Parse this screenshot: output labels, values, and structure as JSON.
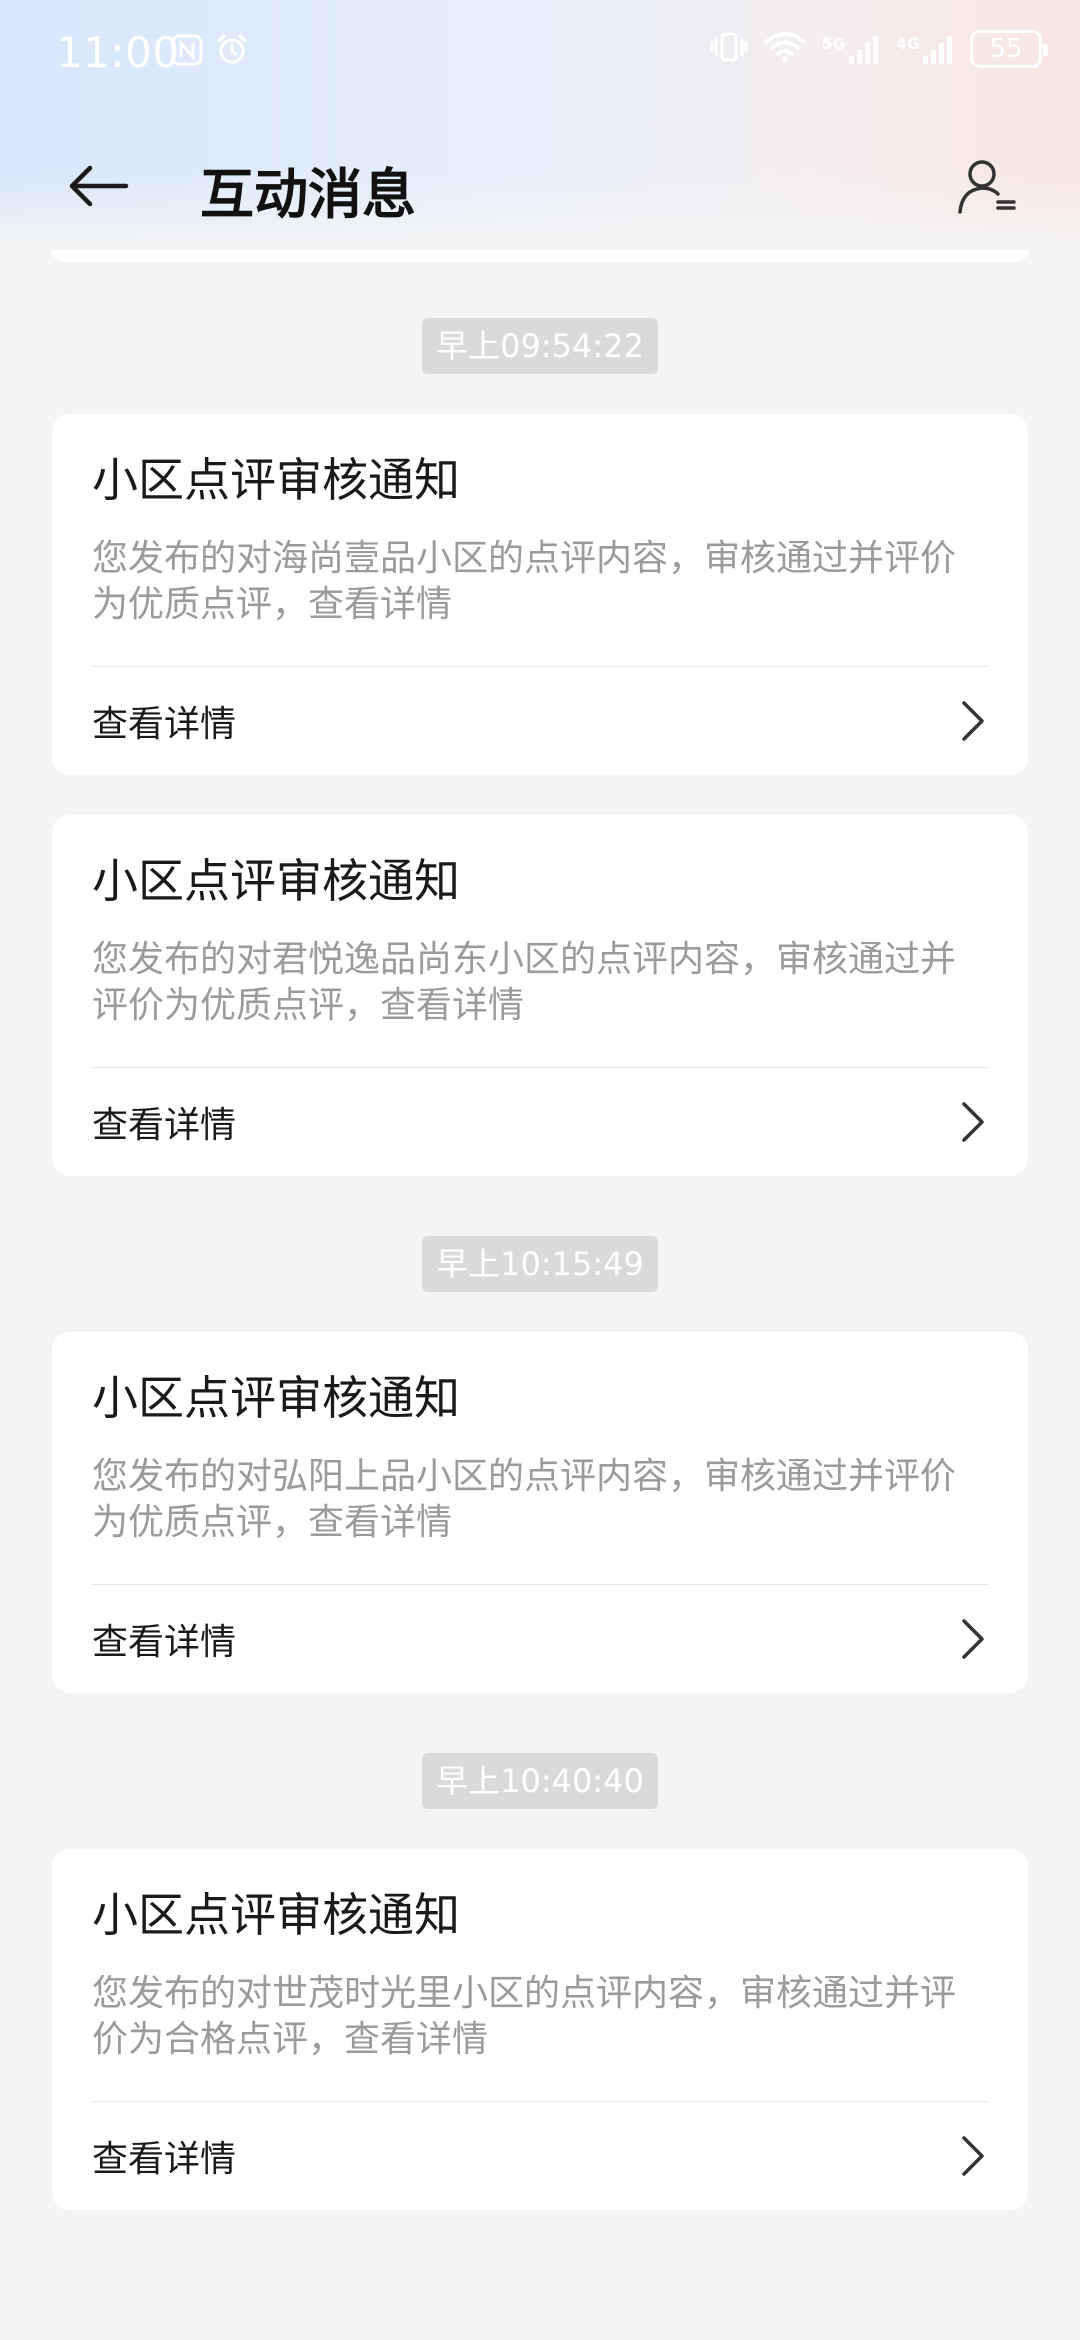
{
  "status_bar": {
    "time": "11:00",
    "battery": "55",
    "network_5g": "5G",
    "network_4g": "4G"
  },
  "header": {
    "title": "互动消息"
  },
  "messages": [
    {
      "time_chip": "早上09:54:22",
      "cards": [
        {
          "title": "小区点评审核通知",
          "desc": "您发布的对海尚壹品小区的点评内容，审核通过并评价为优质点评，查看详情",
          "action": "查看详情"
        },
        {
          "title": "小区点评审核通知",
          "desc": "您发布的对君悦逸品尚东小区的点评内容，审核通过并评价为优质点评，查看详情",
          "action": "查看详情"
        }
      ]
    },
    {
      "time_chip": "早上10:15:49",
      "cards": [
        {
          "title": "小区点评审核通知",
          "desc": "您发布的对弘阳上品小区的点评内容，审核通过并评价为优质点评，查看详情",
          "action": "查看详情"
        }
      ]
    },
    {
      "time_chip": "早上10:40:40",
      "cards": [
        {
          "title": "小区点评审核通知",
          "desc": "您发布的对世茂时光里小区的点评内容，审核通过并评价为合格点评，查看详情",
          "action": "查看详情"
        }
      ]
    }
  ]
}
